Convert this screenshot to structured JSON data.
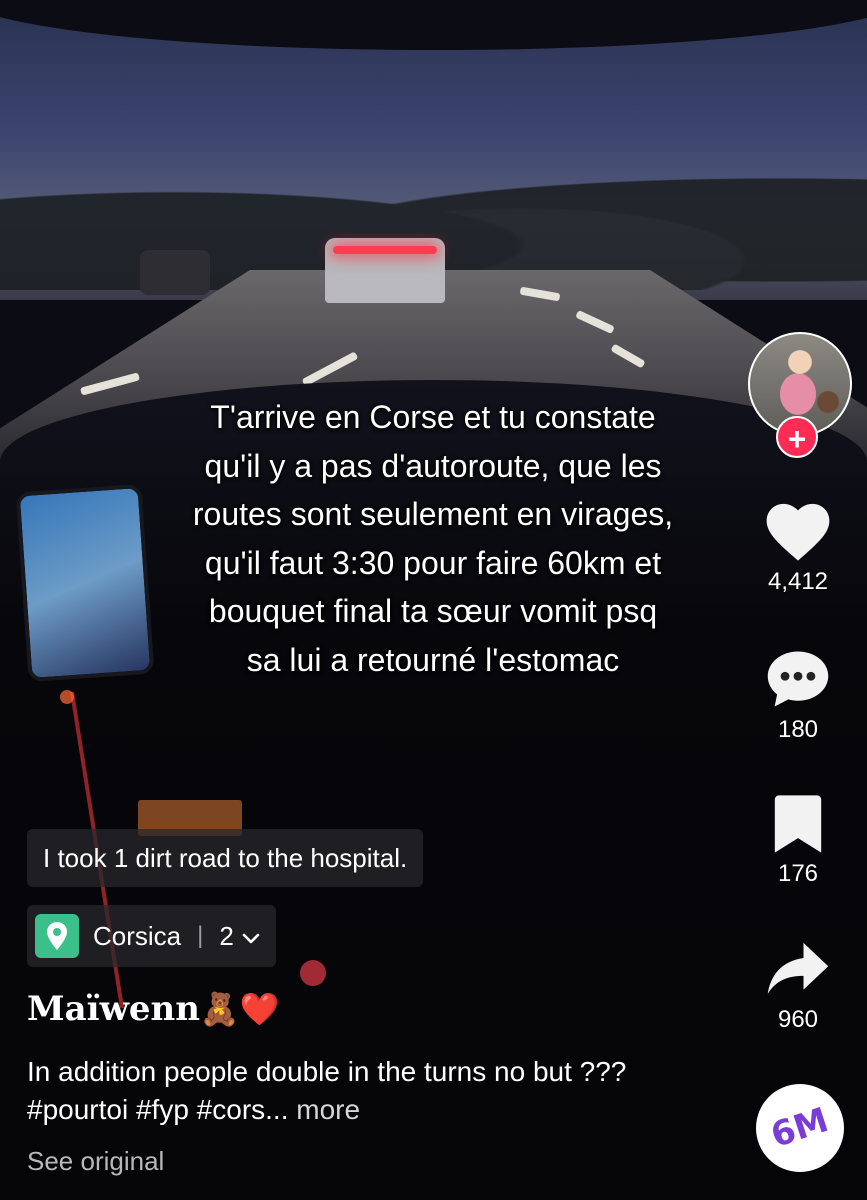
{
  "overlay": {
    "text": "T'arrive en Corse et tu constate\nqu'il y a pas d'autoroute, que les\nroutes sont seulement en virages,\nqu'il faut 3:30 pour faire 60km et\nbouquet final ta sœur vomit psq\nsa lui a retourné l'estomac"
  },
  "rail": {
    "likes": "4,412",
    "comments": "180",
    "saves": "176",
    "shares": "960",
    "follow_symbol": "+",
    "sound_logo": "6M",
    "icons": {
      "like": "heart-icon",
      "comment": "comment-bubble-icon",
      "save": "bookmark-icon",
      "share": "share-arrow-icon"
    }
  },
  "translation": {
    "text": "I took 1 dirt road to the hospital."
  },
  "location": {
    "name": "Corsica",
    "count": "2",
    "icon": "location-pin-icon"
  },
  "user": {
    "name": "Maïwenn",
    "emojis": "🧸❤️"
  },
  "caption": {
    "text": "In addition people double in the turns no but ??? #pourtoi #fyp #cors...",
    "more": "more"
  },
  "see_original": "See original",
  "colors": {
    "follow": "#fe2c55",
    "location_icon": "#3bbf8b",
    "sound_logo": "#7a3cd6"
  }
}
